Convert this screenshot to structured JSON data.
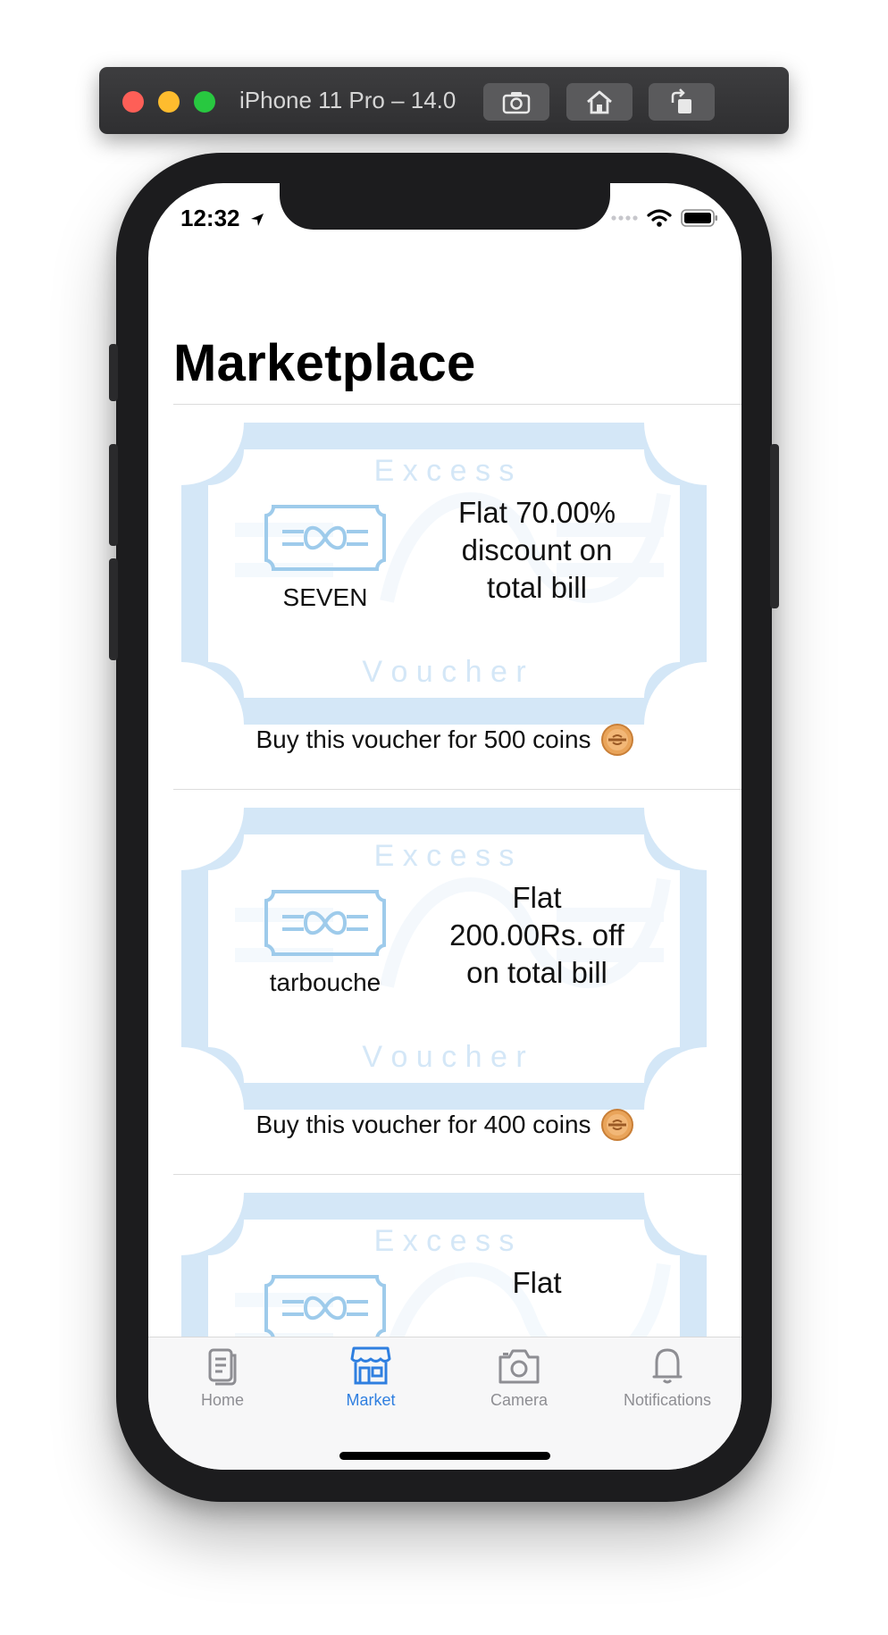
{
  "simulator": {
    "title": "iPhone 11 Pro – 14.0",
    "buttons": [
      "screenshot-icon",
      "home-icon",
      "rotate-icon"
    ]
  },
  "status_bar": {
    "time": "12:32",
    "icons": [
      "location-arrow-icon",
      "signal-dots-icon",
      "wifi-icon",
      "battery-icon"
    ]
  },
  "page": {
    "title": "Marketplace"
  },
  "voucher_watermark": {
    "top": "E x c e s s",
    "bottom": "V o u c h e r"
  },
  "vouchers": [
    {
      "brand": "SEVEN",
      "offer_lines": [
        "Flat 70.00%",
        "discount on",
        "total bill"
      ],
      "buy_text": "Buy this voucher for 500 coins"
    },
    {
      "brand": "tarbouche",
      "offer_lines": [
        "Flat",
        "200.00Rs. off",
        "on total bill"
      ],
      "buy_text": "Buy this voucher for 400 coins"
    },
    {
      "brand": "",
      "offer_lines": [
        "Flat"
      ],
      "buy_text": ""
    }
  ],
  "tab_bar": {
    "tabs": [
      {
        "label": "Home",
        "icon": "home-doc-icon",
        "active": false
      },
      {
        "label": "Market",
        "icon": "storefront-icon",
        "active": true
      },
      {
        "label": "Camera",
        "icon": "camera-icon",
        "active": false
      },
      {
        "label": "Notifications",
        "icon": "bell-icon",
        "active": false
      }
    ]
  },
  "colors": {
    "accent": "#2f7fe0",
    "voucher_tint": "#d4e7f7",
    "coin": "#e9a45a"
  }
}
